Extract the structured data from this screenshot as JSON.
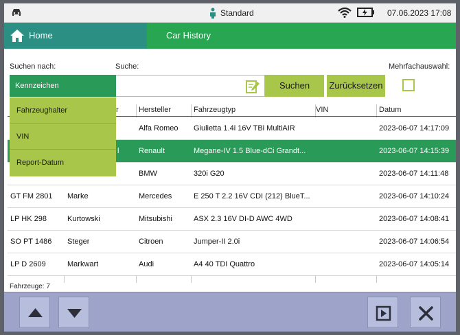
{
  "statusbar": {
    "mode": "Standard",
    "datetime": "07.06.2023 17:08",
    "icons": [
      "car-icon",
      "user-icon",
      "wifi-icon",
      "battery-icon"
    ]
  },
  "tabs": [
    {
      "label": "Home",
      "active": false
    },
    {
      "label": "Car History",
      "active": true
    }
  ],
  "search": {
    "search_by_label": "Suchen nach:",
    "search_label": "Suche:",
    "multi_label": "Mehrfachauswahl:",
    "search_value": "",
    "search_button": "Suchen",
    "reset_button": "Zurücksetzen",
    "multi_checked": false
  },
  "dropdown": {
    "selected": "Kennzeichen",
    "options": [
      "Fahrzeughalter",
      "VIN",
      "Report-Datum"
    ]
  },
  "table": {
    "headers": [
      "Hersteller",
      "Fahrzeugtyp",
      "VIN",
      "Datum"
    ],
    "halter_header_fragment": "r",
    "rows": [
      {
        "plate": "",
        "owner": "",
        "make": "Alfa Romeo",
        "type": "Giulietta 1.4i 16V TBi MultiAIR",
        "vin": "",
        "date": "2023-06-07 14:17:09"
      },
      {
        "plate": "",
        "owner": "l",
        "make": "Renault",
        "type": "Megane-IV 1.5 Blue-dCi Grandt...",
        "vin": "",
        "date": "2023-06-07 14:15:39",
        "selected": true
      },
      {
        "plate": "",
        "owner": "",
        "make": "BMW",
        "type": "320i G20",
        "vin": "",
        "date": "2023-06-07 14:11:48"
      },
      {
        "plate": "GT FM 2801",
        "owner": "Marke",
        "make": "Mercedes",
        "type": "E 250 T 2.2 16V CDI (212) BlueT...",
        "vin": "",
        "date": "2023-06-07 14:10:24"
      },
      {
        "plate": "LP HK 298",
        "owner": "Kurtowski",
        "make": "Mitsubishi",
        "type": "ASX 2.3 16V DI-D AWC 4WD",
        "vin": "",
        "date": "2023-06-07 14:08:41"
      },
      {
        "plate": "SO PT 1486",
        "owner": "Steger",
        "make": "Citroen",
        "type": "Jumper-II 2.0i",
        "vin": "",
        "date": "2023-06-07 14:06:54"
      },
      {
        "plate": "LP D 2609",
        "owner": "Markwart",
        "make": "Audi",
        "type": "A4 40 TDI Quattro",
        "vin": "",
        "date": "2023-06-07 14:05:14"
      }
    ]
  },
  "footer": {
    "count_label": "Fahrzeuge: 7",
    "buttons": [
      "up-arrow-icon",
      "down-arrow-icon",
      "play-icon",
      "close-icon"
    ]
  },
  "colors": {
    "accent_green": "#29a652",
    "row_selected": "#2a9a58",
    "tab_home": "#2c8f83",
    "button_lime": "#a8c64a",
    "footer_bg": "#9da3c9"
  }
}
